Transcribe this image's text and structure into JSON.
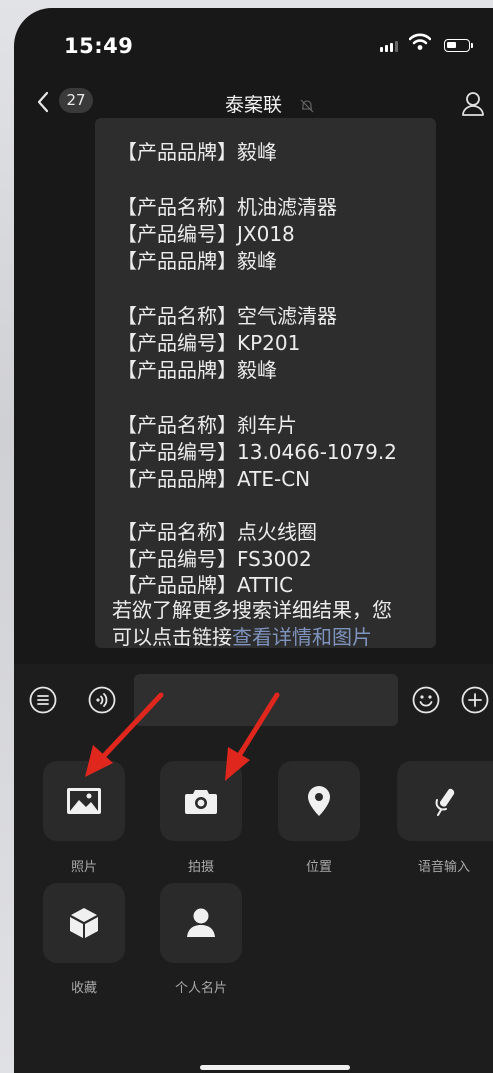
{
  "status_bar": {
    "time": "15:49"
  },
  "nav": {
    "unread_count": "27",
    "title": "泰案联"
  },
  "message": {
    "lines": [
      "【产品品牌】毅峰",
      "【产品名称】机油滤清器",
      "【产品编号】JX018",
      "【产品品牌】毅峰",
      "【产品名称】空气滤清器",
      "【产品编号】KP201",
      "【产品品牌】毅峰",
      "【产品名称】刹车片",
      "【产品编号】13.0466-1079.2",
      "【产品品牌】ATE-CN",
      "【产品名称】点火线圈",
      "【产品编号】FS3002",
      "【产品品牌】ATTIC",
      "若欲了解更多搜索详细结果，您",
      "可以点击链接"
    ],
    "link_text": "查看详情和图片"
  },
  "toolbar": {
    "input_value": ""
  },
  "panel": {
    "items": [
      {
        "label": "照片",
        "icon": "photo-icon"
      },
      {
        "label": "拍摄",
        "icon": "camera-icon"
      },
      {
        "label": "位置",
        "icon": "location-icon"
      },
      {
        "label": "语音输入",
        "icon": "microphone-icon"
      },
      {
        "label": "收藏",
        "icon": "favorites-cube-icon"
      },
      {
        "label": "个人名片",
        "icon": "contact-card-icon"
      }
    ]
  },
  "colors": {
    "background": "#181818",
    "bubble": "#2d2d2d",
    "link": "#7e93bd",
    "annotation_arrow": "#e0271e"
  }
}
